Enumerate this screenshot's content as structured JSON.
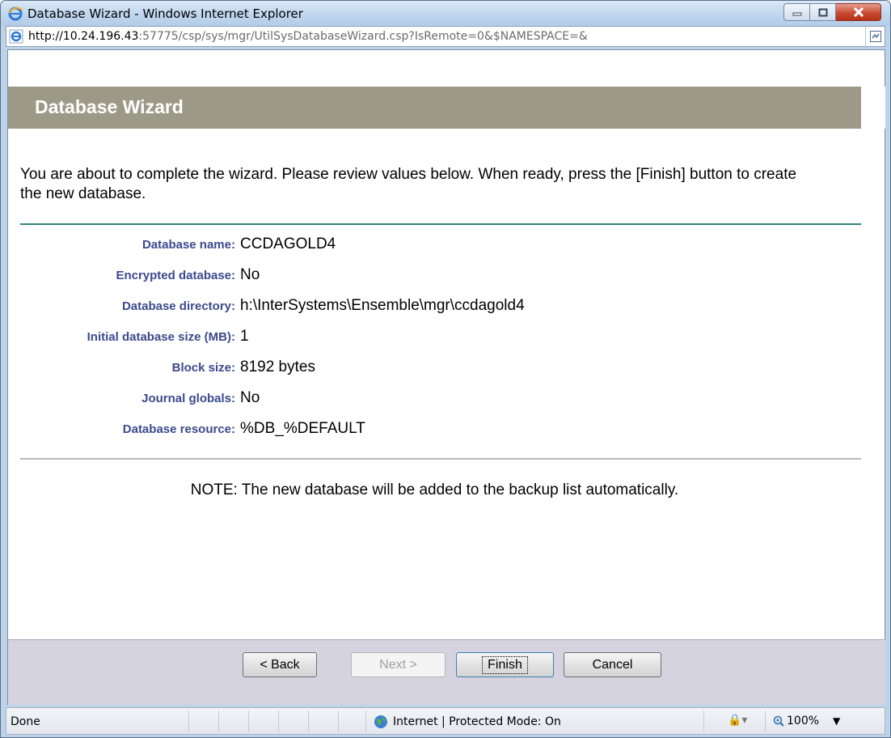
{
  "window": {
    "title": "Database Wizard - Windows Internet Explorer",
    "url_host": "http://10.24.196.43",
    "url_rest": ":57775/csp/sys/mgr/UtilSysDatabaseWizard.csp?IsRemote=0&$NAMESPACE=&"
  },
  "page": {
    "header_title": "Database Wizard",
    "intro": "You are about to complete the wizard. Please review values below. When ready, press the [Finish] button to create the new database.",
    "fields": [
      {
        "label": "Database name:",
        "value": "CCDAGOLD4"
      },
      {
        "label": "Encrypted database:",
        "value": "No"
      },
      {
        "label": "Database directory:",
        "value": "h:\\InterSystems\\Ensemble\\mgr\\ccdagold4"
      },
      {
        "label": "Initial database size (MB):",
        "value": "1"
      },
      {
        "label": "Block size:",
        "value": "8192 bytes"
      },
      {
        "label": "Journal globals:",
        "value": "No"
      },
      {
        "label": "Database resource:",
        "value": "%DB_%DEFAULT"
      }
    ],
    "note": "NOTE: The new database will be added to the backup list automatically."
  },
  "buttons": {
    "back": "< Back",
    "next": "Next >",
    "finish": "Finish",
    "cancel": "Cancel"
  },
  "status": {
    "text": "Done",
    "zone": "Internet | Protected Mode: On",
    "zoom": "100%"
  },
  "colors": {
    "header_bg": "#9c9a87",
    "label": "#3b4a8c",
    "teal_rule": "#33837a",
    "footer_bg": "#d6d3e1"
  }
}
